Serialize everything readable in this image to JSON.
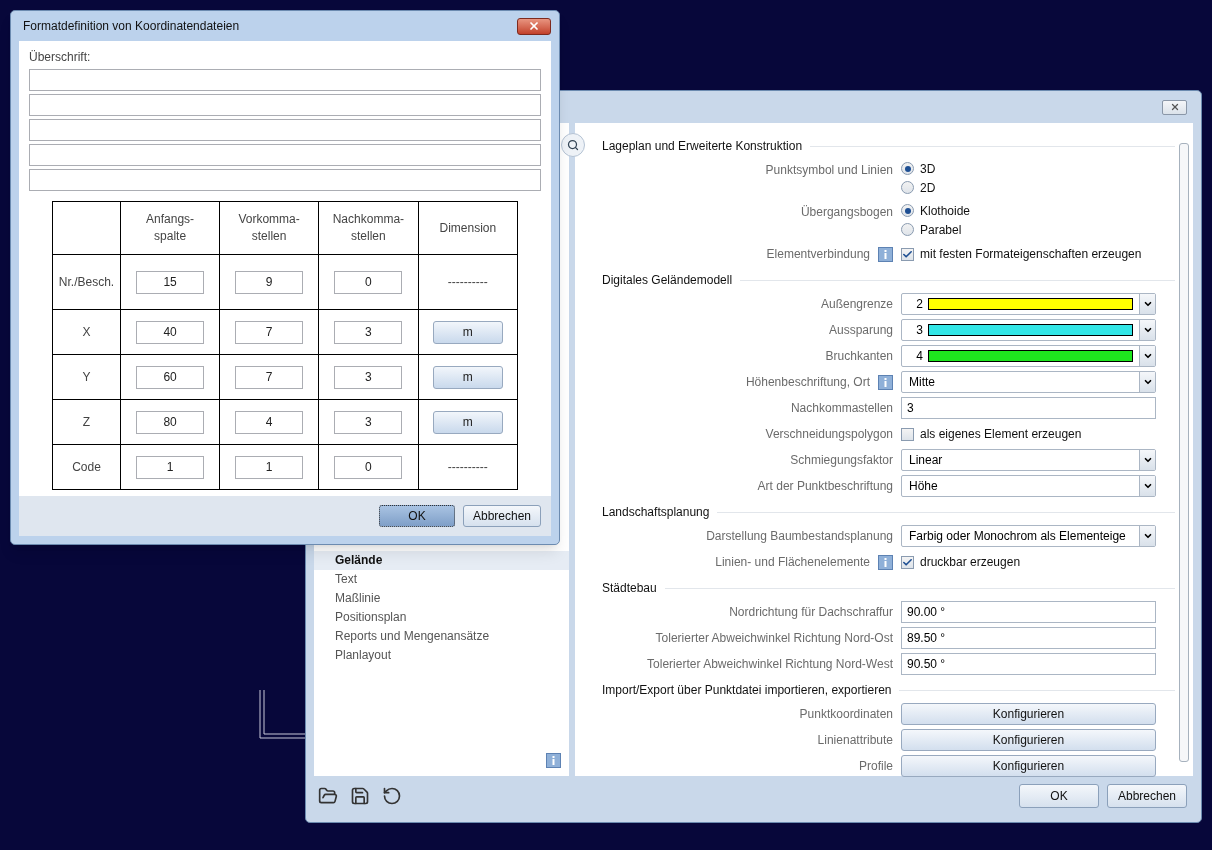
{
  "format_dialog": {
    "title": "Formatdefinition von Koordinatendateien",
    "heading_label": "Überschrift:",
    "heading_fields": [
      {
        "kind": "line"
      },
      {
        "kind": "line"
      },
      {
        "kind": "line"
      },
      {
        "kind": "line"
      },
      {
        "kind": "line"
      }
    ],
    "table": {
      "columns": [
        [
          "Anfangs-",
          "spalte"
        ],
        [
          "Vorkomma-",
          "stellen"
        ],
        [
          "Nachkomma-",
          "stellen"
        ],
        [
          "Dimension"
        ]
      ],
      "rows": [
        {
          "label": "Nr./Besch.",
          "values": [
            "15",
            "9",
            "0"
          ],
          "dimension": {
            "kind": "text",
            "text": "----------"
          }
        },
        {
          "label": "X",
          "values": [
            "40",
            "7",
            "3"
          ],
          "dimension": {
            "kind": "button",
            "text": "m"
          }
        },
        {
          "label": "Y",
          "values": [
            "60",
            "7",
            "3"
          ],
          "dimension": {
            "kind": "button",
            "text": "m"
          }
        },
        {
          "label": "Z",
          "values": [
            "80",
            "4",
            "3"
          ],
          "dimension": {
            "kind": "button",
            "text": "m"
          }
        },
        {
          "label": "Code",
          "values": [
            "1",
            "1",
            "0"
          ],
          "dimension": {
            "kind": "text",
            "text": "----------"
          }
        }
      ]
    },
    "buttons": [
      {
        "label": "OK",
        "default": true
      },
      {
        "label": "Abbrechen",
        "default": false
      }
    ]
  },
  "options_dialog": {
    "sidebar": {
      "items": [
        {
          "label": "Gelände",
          "selected": true
        },
        {
          "label": "Text",
          "selected": false
        },
        {
          "label": "Maßlinie",
          "selected": false
        },
        {
          "label": "Positionsplan",
          "selected": false
        },
        {
          "label": "Reports und Mengenansätze",
          "selected": false
        },
        {
          "label": "Planlayout",
          "selected": false
        }
      ]
    },
    "sections": [
      {
        "title": "Lageplan und Erweiterte Konstruktion",
        "rows": [
          {
            "label": "Punktsymbol und Linien",
            "info": false,
            "control": {
              "kind": "radio",
              "options": [
                {
                  "label": "3D",
                  "selected": true
                },
                {
                  "label": "2D",
                  "selected": false
                }
              ]
            }
          },
          {
            "label": "Übergangsbogen",
            "info": false,
            "control": {
              "kind": "radio",
              "options": [
                {
                  "label": "Klothoide",
                  "selected": true
                },
                {
                  "label": "Parabel",
                  "selected": false
                }
              ]
            }
          },
          {
            "label": "Elementverbindung",
            "info": true,
            "control": {
              "kind": "checkbox",
              "label": "mit festen Formateigenschaften erzeugen",
              "checked": true
            }
          }
        ]
      },
      {
        "title": "Digitales Geländemodell",
        "rows": [
          {
            "label": "Außengrenze",
            "info": false,
            "control": {
              "kind": "color_select",
              "value": "2",
              "color": "#ffff00"
            }
          },
          {
            "label": "Aussparung",
            "info": false,
            "control": {
              "kind": "color_select",
              "value": "3",
              "color": "#33e6e6"
            }
          },
          {
            "label": "Bruchkanten",
            "info": false,
            "control": {
              "kind": "color_select",
              "value": "4",
              "color": "#1ee61e"
            }
          },
          {
            "label": "Höhenbeschriftung, Ort",
            "info": true,
            "control": {
              "kind": "select",
              "value": "Mitte"
            }
          },
          {
            "label": "Nachkommastellen",
            "info": false,
            "control": {
              "kind": "input",
              "value": "3"
            }
          },
          {
            "label": "Verschneidungspolygon",
            "info": false,
            "control": {
              "kind": "checkbox",
              "label": "als eigenes Element erzeugen",
              "checked": false
            }
          },
          {
            "label": "Schmiegungsfaktor",
            "info": false,
            "control": {
              "kind": "select",
              "value": "Linear"
            }
          },
          {
            "label": "Art der Punktbeschriftung",
            "info": false,
            "control": {
              "kind": "select",
              "value": "Höhe"
            }
          }
        ]
      },
      {
        "title": "Landschaftsplanung",
        "rows": [
          {
            "label": "Darstellung Baumbestandsplanung",
            "info": false,
            "control": {
              "kind": "select",
              "value": "Farbig oder Monochrom als Elementeige"
            }
          },
          {
            "label": "Linien- und Flächenelemente",
            "info": true,
            "control": {
              "kind": "checkbox",
              "label": "druckbar erzeugen",
              "checked": true
            }
          }
        ]
      },
      {
        "title": "Städtebau",
        "rows": [
          {
            "label": "Nordrichtung für Dachschraffur",
            "info": false,
            "control": {
              "kind": "input",
              "value": "90.00 °"
            }
          },
          {
            "label": "Tolerierter Abweichwinkel Richtung Nord-Ost",
            "info": false,
            "control": {
              "kind": "input",
              "value": "89.50 °"
            }
          },
          {
            "label": "Tolerierter Abweichwinkel Richtung Nord-West",
            "info": false,
            "control": {
              "kind": "input",
              "value": "90.50 °"
            }
          }
        ]
      },
      {
        "title": "Import/Export über Punktdatei importieren, exportieren",
        "rows": [
          {
            "label": "Punktkoordinaten",
            "info": false,
            "control": {
              "kind": "button",
              "label": "Konfigurieren"
            }
          },
          {
            "label": "Linienattribute",
            "info": false,
            "control": {
              "kind": "button",
              "label": "Konfigurieren"
            }
          },
          {
            "label": "Profile",
            "info": false,
            "control": {
              "kind": "button",
              "label": "Konfigurieren"
            }
          }
        ]
      }
    ],
    "buttons": [
      {
        "label": "OK",
        "default": false
      },
      {
        "label": "Abbrechen",
        "default": false
      }
    ]
  }
}
